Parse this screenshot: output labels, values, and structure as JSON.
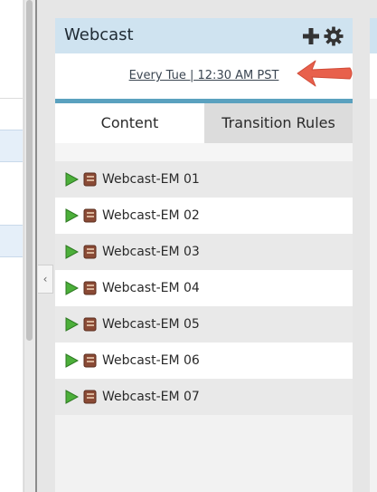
{
  "panel": {
    "title": "Webcast",
    "schedule": "Every Tue | 12:30 AM PST"
  },
  "tabs": {
    "content": "Content",
    "transition_rules": "Transition Rules"
  },
  "items": [
    {
      "label": "Webcast-EM 01"
    },
    {
      "label": "Webcast-EM 02"
    },
    {
      "label": "Webcast-EM 03"
    },
    {
      "label": "Webcast-EM 04"
    },
    {
      "label": "Webcast-EM 05"
    },
    {
      "label": "Webcast-EM 06"
    },
    {
      "label": "Webcast-EM 07"
    }
  ],
  "sidebar": {
    "collapse_glyph": "‹"
  },
  "icons": {
    "header_actions": [
      "add-icon",
      "gear-icon"
    ],
    "item_icons": [
      "play-icon",
      "asset-icon"
    ],
    "annotation": "red-arrow-icon"
  },
  "colors": {
    "header_bg": "#cfe3f0",
    "accent_bar": "#5aa1bf",
    "play_green": "#4caf3a",
    "asset_brown": "#8a4a35",
    "annotation_red": "#e8604c",
    "selected_row": "#e5eff9"
  }
}
